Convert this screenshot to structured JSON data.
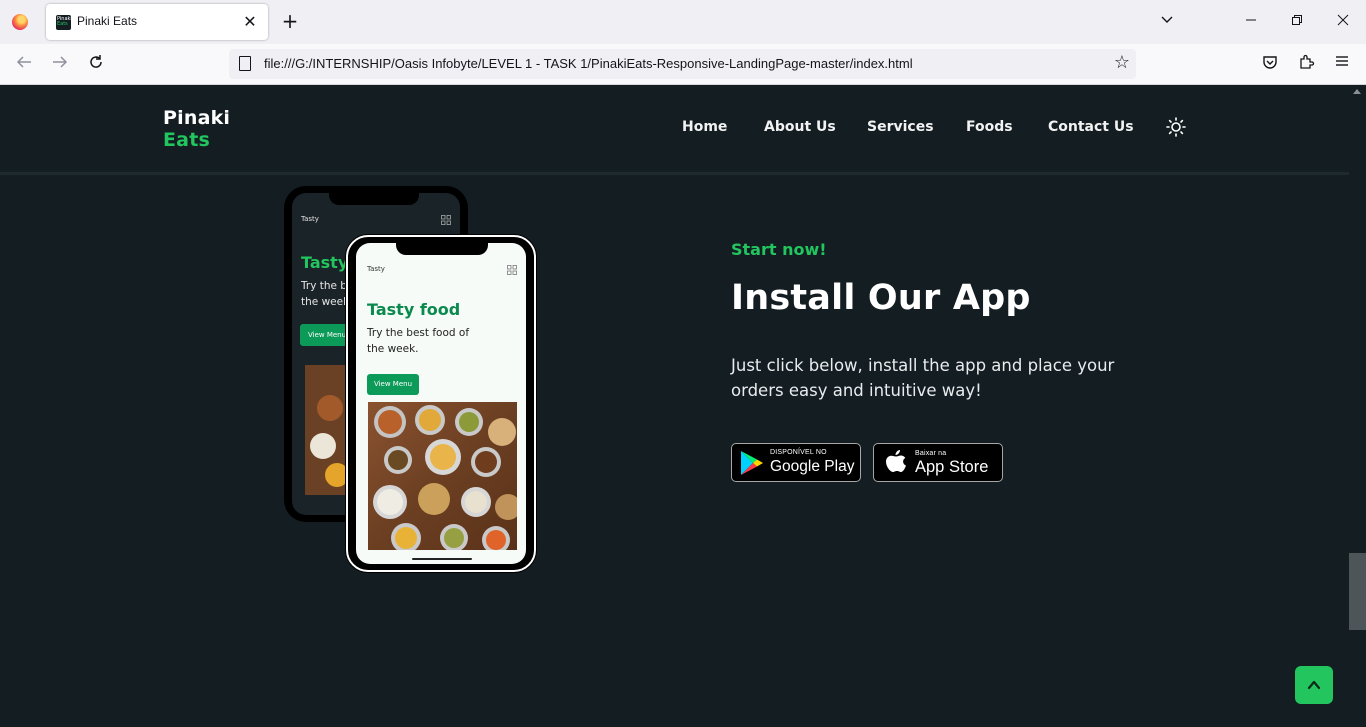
{
  "browser": {
    "tab_title": "Pinaki Eats",
    "tab_favicon_text": [
      "Pinaki",
      "Eats"
    ],
    "url": "file:///G:/INTERNSHIP/Oasis Infobyte/LEVEL 1 - TASK 1/PinakiEats-Responsive-LandingPage-master/index.html"
  },
  "site": {
    "brand_line1": "Pinaki",
    "brand_line2": "Eats",
    "nav": [
      "Home",
      "About Us",
      "Services",
      "Foods",
      "Contact Us"
    ]
  },
  "app_section": {
    "tagline": "Start now!",
    "title": "Install Our App",
    "description": "Just click below, install the app and place your orders easy and intuitive way!",
    "google_play": {
      "small": "DISPONÍVEL NO",
      "big": "Google Play"
    },
    "app_store": {
      "small": "Baixar na",
      "big": "App Store"
    }
  },
  "phone_mockup": {
    "brand": "Tasty",
    "headline": "Tasty food",
    "line1": "Try the best food of",
    "line2": "the week.",
    "button": "View Menu",
    "back_headline": "Tasty",
    "back_line1": "Try the b",
    "back_line2": "the week",
    "back_button": "View Menu"
  },
  "colors": {
    "background": "#131d22",
    "accent": "#22c55e",
    "text": "#ffffff"
  }
}
